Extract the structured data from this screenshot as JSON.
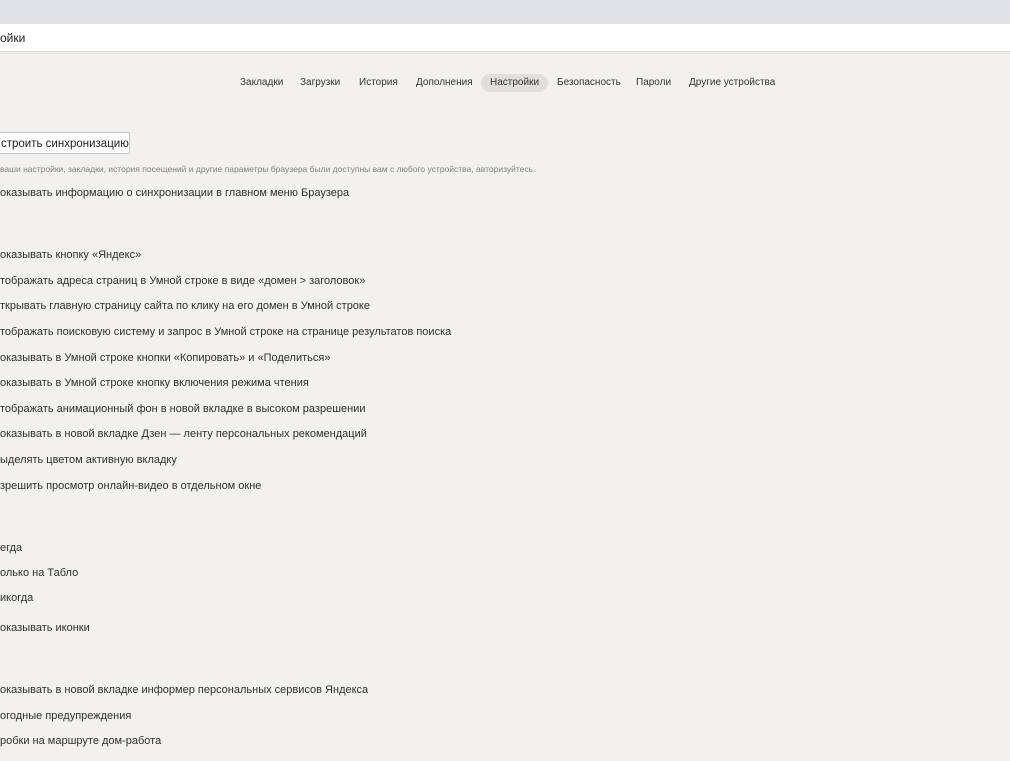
{
  "addressbar": {
    "text": "ойки"
  },
  "nav": {
    "tabs": [
      {
        "label": "Закладки"
      },
      {
        "label": "Загрузки"
      },
      {
        "label": "История"
      },
      {
        "label": "Дополнения"
      },
      {
        "label": "Настройки",
        "active": true
      },
      {
        "label": "Безопасность"
      },
      {
        "label": "Пароли"
      },
      {
        "label": "Другие устройства"
      }
    ]
  },
  "sync": {
    "button_label": "строить синхронизацию",
    "hint": "ваши настройки, закладки, история посещений и другие параметры браузера были доступны вам с любого устройства, авторизуйтесь.",
    "show_info": "оказывать информацию о синхронизации в главном меню Браузера"
  },
  "appearance": {
    "options": [
      "оказывать кнопку «Яндекс»",
      "тображать адреса страниц в Умной строке в виде «домен > заголовок»",
      "ткрывать главную страницу сайта по клику на его домен в Умной строке",
      "тображать поисковую систему и запрос в Умной строке на странице результатов поиска",
      "оказывать в Умной строке кнопки «Копировать» и «Поделиться»",
      "оказывать в Умной строке кнопку включения режима чтения",
      "тображать анимационный фон в новой вкладке в высоком разрешении",
      "оказывать в новой вкладке Дзен — ленту персональных рекомендаций",
      "ыделять цветом активную вкладку",
      "зрешить просмотр онлайн-видео в отдельном окне"
    ]
  },
  "bookmarks_bar": {
    "choices": [
      "егда",
      "олько на Табло",
      "икогда"
    ],
    "show_icons": "оказывать иконки"
  },
  "informer": {
    "options": [
      "оказывать в новой вкладке информер персональных сервисов Яндекса",
      "огодные предупреждения",
      "робки на маршруте дом-работа"
    ]
  },
  "colors": {
    "page_bg": "#f2f1f0",
    "topbar_bg": "#dfe1e6",
    "active_tab_bg": "#e0dfdd"
  }
}
